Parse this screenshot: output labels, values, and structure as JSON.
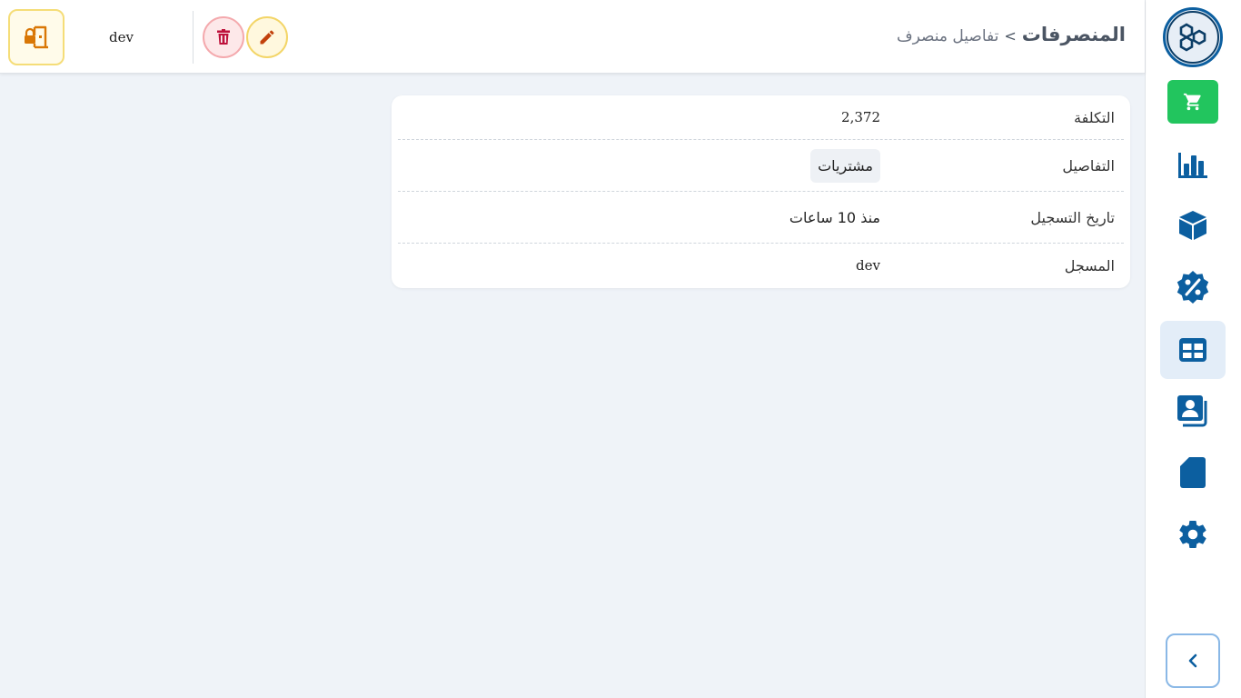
{
  "header": {
    "breadcrumb_root": "المنصرفات",
    "breadcrumb_separator": ">",
    "breadcrumb_current": "تفاصيل منصرف",
    "username": "dev"
  },
  "sidebar": {
    "items": [
      {
        "icon": "cart-icon"
      },
      {
        "icon": "bar-chart-icon"
      },
      {
        "icon": "box-icon"
      },
      {
        "icon": "discount-badge-icon"
      },
      {
        "icon": "table-icon",
        "active": true
      },
      {
        "icon": "contacts-book-icon"
      },
      {
        "icon": "file-icon"
      },
      {
        "icon": "gear-icon"
      }
    ]
  },
  "details": {
    "cost_label": "التكلفة",
    "cost_value": "2,372",
    "details_label": "التفاصيل",
    "details_value": "مشتريات",
    "date_label": "تاريخ التسجيل",
    "date_value": "منذ 10 ساعات",
    "registrar_label": "المسجل",
    "registrar_value": "dev"
  },
  "colors": {
    "accent": "#0c5fa0",
    "cart_green": "#22c55e",
    "delete_red": "#be123c",
    "edit_yellow": "#d97706"
  }
}
